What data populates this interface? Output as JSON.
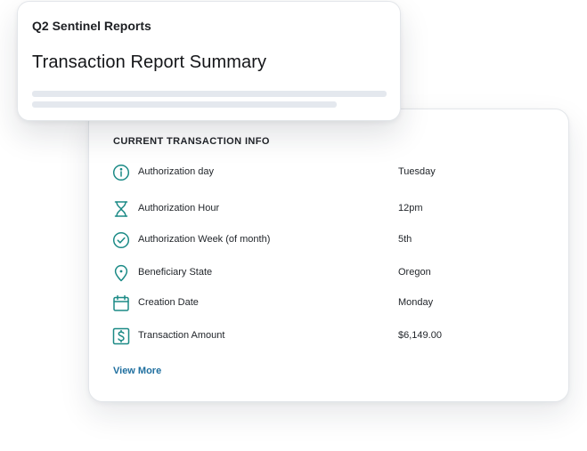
{
  "summary": {
    "app_title": "Q2 Sentinel Reports",
    "page_title": "Transaction Report Summary"
  },
  "info": {
    "heading": "CURRENT TRANSACTION INFO",
    "rows": [
      {
        "icon": "info-circle-icon",
        "label": "Authorization day",
        "value": "Tuesday"
      },
      {
        "icon": "hourglass-icon",
        "label": "Authorization Hour",
        "value": "12pm"
      },
      {
        "icon": "check-circle-icon",
        "label": "Authorization Week (of month)",
        "value": "5th"
      },
      {
        "icon": "location-pin-icon",
        "label": "Beneficiary State",
        "value": "Oregon"
      },
      {
        "icon": "calendar-icon",
        "label": "Creation Date",
        "value": "Monday"
      },
      {
        "icon": "dollar-icon",
        "label": "Transaction Amount",
        "value": "$6,149.00"
      }
    ],
    "view_more": "View More"
  },
  "colors": {
    "icon_teal": "#1b8a86",
    "link_blue": "#1f6f9f",
    "skeleton": "#e4e8ee"
  }
}
